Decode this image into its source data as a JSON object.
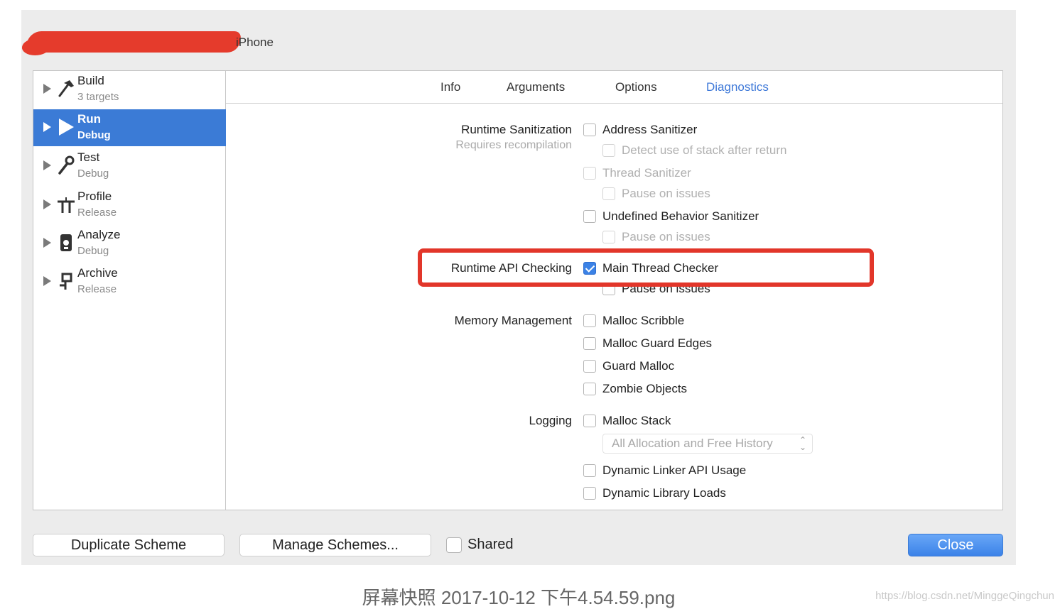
{
  "window": {
    "scheme_title": "iPhone"
  },
  "sidebar": {
    "actions": [
      {
        "name": "Build",
        "sub": "3 targets",
        "icon": "hammer-icon"
      },
      {
        "name": "Run",
        "sub": "Debug",
        "icon": "play-icon",
        "selected": true
      },
      {
        "name": "Test",
        "sub": "Debug",
        "icon": "wrench-icon"
      },
      {
        "name": "Profile",
        "sub": "Release",
        "icon": "instruments-icon"
      },
      {
        "name": "Analyze",
        "sub": "Debug",
        "icon": "analyze-icon"
      },
      {
        "name": "Archive",
        "sub": "Release",
        "icon": "archive-icon"
      }
    ]
  },
  "tabs": [
    {
      "label": "Info"
    },
    {
      "label": "Arguments"
    },
    {
      "label": "Options"
    },
    {
      "label": "Diagnostics",
      "active": true
    }
  ],
  "diagnostics": {
    "runtime_sanitization": {
      "label": "Runtime Sanitization",
      "sublabel": "Requires recompilation",
      "address_sanitizer": "Address Sanitizer",
      "detect_stack": "Detect use of stack after return",
      "thread_sanitizer": "Thread Sanitizer",
      "thread_pause": "Pause on issues",
      "ub_sanitizer": "Undefined Behavior Sanitizer",
      "ub_pause": "Pause on issues"
    },
    "runtime_api": {
      "label": "Runtime API Checking",
      "main_thread_checker": "Main Thread Checker",
      "main_thread_checked": true,
      "pause": "Pause on issues"
    },
    "memory": {
      "label": "Memory Management",
      "malloc_scribble": "Malloc Scribble",
      "malloc_guard_edges": "Malloc Guard Edges",
      "guard_malloc": "Guard Malloc",
      "zombie_objects": "Zombie Objects"
    },
    "logging": {
      "label": "Logging",
      "malloc_stack": "Malloc Stack",
      "history_select": "All Allocation and Free History",
      "dynamic_linker": "Dynamic Linker API Usage",
      "dynamic_library": "Dynamic Library Loads"
    }
  },
  "footer": {
    "duplicate": "Duplicate Scheme",
    "manage": "Manage Schemes...",
    "shared": "Shared",
    "close": "Close"
  },
  "caption": "屏幕快照 2017-10-12 下午4.54.59.png",
  "watermark": "https://blog.csdn.net/MinggeQingchun",
  "colors": {
    "accent": "#3b7bd6",
    "tab_active": "#3d78d8",
    "highlight": "#e2362a"
  }
}
